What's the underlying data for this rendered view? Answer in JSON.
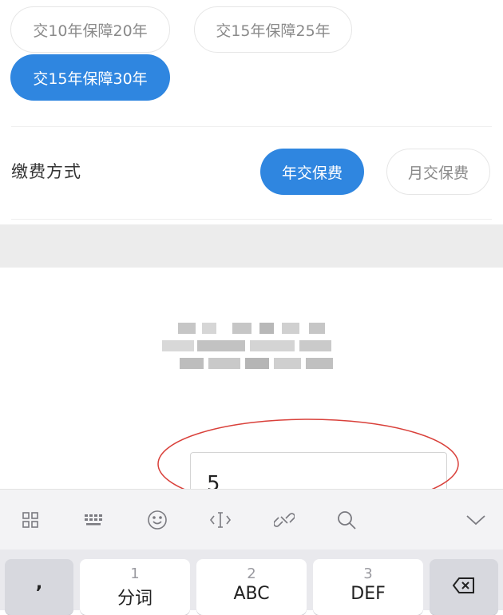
{
  "term_options": [
    {
      "label": "交10年保障20年",
      "selected": false
    },
    {
      "label": "交15年保障25年",
      "selected": false
    },
    {
      "label": "交15年保障30年",
      "selected": true
    }
  ],
  "payment": {
    "label": "缴费方式",
    "options": [
      {
        "label": "年交保费",
        "selected": true
      },
      {
        "label": "月交保费",
        "selected": false
      }
    ]
  },
  "input": {
    "value": "5"
  },
  "keyboard": {
    "toolbar_icons": [
      "grid-icon",
      "keyboard-icon",
      "emoji-icon",
      "cursor-icon",
      "link-icon",
      "search-icon",
      "collapse-icon"
    ],
    "keys": [
      {
        "number": "",
        "label": ","
      },
      {
        "number": "1",
        "label": "分词"
      },
      {
        "number": "2",
        "label": "ABC"
      },
      {
        "number": "3",
        "label": "DEF"
      },
      {
        "number": "",
        "label": "backspace-icon"
      }
    ]
  },
  "colors": {
    "accent": "#2f86e0",
    "annotation": "#d9403a"
  }
}
